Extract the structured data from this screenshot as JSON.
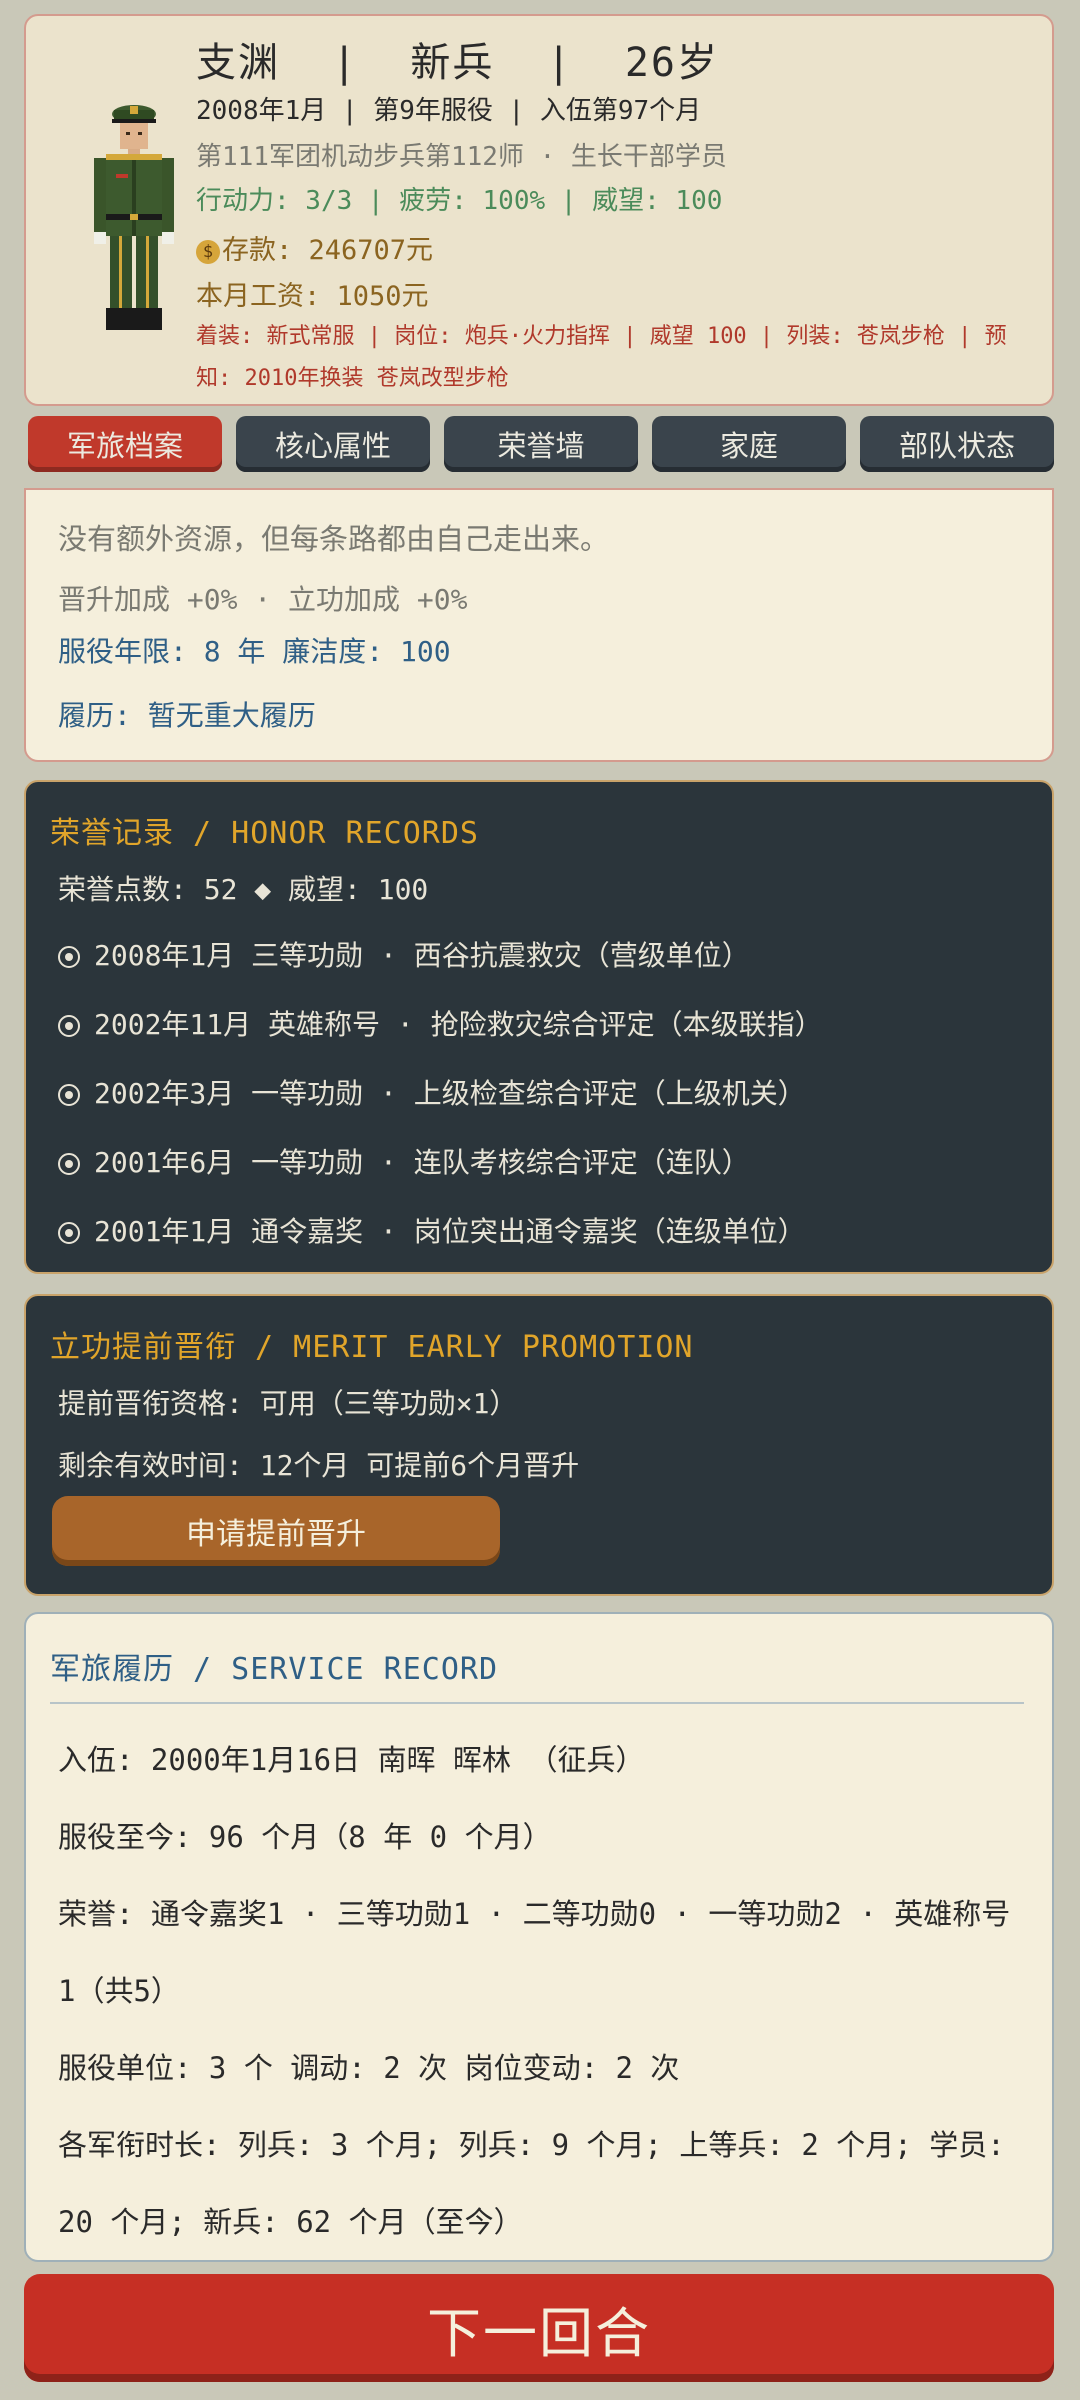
{
  "profile": {
    "name_line": "支渊  |  新兵  |  26岁",
    "date_line": "2008年1月 | 第9年服役 | 入伍第97个月",
    "unit_line": "第111军团机动步兵第112师 · 生长干部学员",
    "stat_line": "行动力: 3/3 | 疲劳: 100% | 威望: 100",
    "savings_icon": "money-bag-icon",
    "savings": "存款: 246707元",
    "wage": "本月工资: 1050元",
    "note": "着装: 新式常服 | 岗位: 炮兵·火力指挥 | 威望 100 | 列装: 苍岚步枪 | 预知: 2010年换装 苍岚改型步枪"
  },
  "tabs": [
    "军旅档案",
    "核心属性",
    "荣誉墙",
    "家庭",
    "部队状态"
  ],
  "active_tab": 0,
  "summary": {
    "motto": "没有额外资源，但每条路都由自己走出来。",
    "bonus": "晋升加成 +0% · 立功加成 +0%",
    "years": "服役年限: 8 年  廉洁度: 100",
    "resume": "履历: 暂无重大履历"
  },
  "honor": {
    "title": "荣誉记录 / HONOR RECORDS",
    "points": "荣誉点数: 52 ◆  威望: 100",
    "records": [
      "2008年1月 三等功勋 · 西谷抗震救灾（营级单位）",
      "2002年11月 英雄称号 · 抢险救灾综合评定（本级联指）",
      "2002年3月 一等功勋 · 上级检查综合评定（上级机关）",
      "2001年6月 一等功勋 · 连队考核综合评定（连队）",
      "2001年1月 通令嘉奖 · 岗位突出通令嘉奖（连级单位）"
    ]
  },
  "merit": {
    "title": "立功提前晋衔 / MERIT EARLY PROMOTION",
    "eligibility": "提前晋衔资格: 可用（三等功勋×1）",
    "remaining": "剩余有效时间: 12个月  可提前6个月晋升",
    "button": "申请提前晋升"
  },
  "service": {
    "title": "军旅履历 / SERVICE RECORD",
    "enlist": "入伍: 2000年1月16日  南晖 晖林  （征兵）",
    "duration": "服役至今: 96 个月（8 年 0 个月）",
    "honors": "荣誉: 通令嘉奖1 · 三等功勋1 · 二等功勋0 · 一等功勋2 · 英雄称号1（共5）",
    "units": "服役单位: 3 个  调动: 2 次  岗位变动: 2 次",
    "ranks": "各军衔时长: 列兵: 3 个月; 列兵: 9 个月; 上等兵: 2 个月; 学员: 20 个月; 新兵: 62 个月（至今）"
  },
  "next_button": "下一回合",
  "colors": {
    "background": "#c9c8b8",
    "accent_red": "#c0392b",
    "gold": "#e1a52a",
    "dark_panel": "#2b353b",
    "blue_text": "#2f5f86",
    "green_text": "#4b8b5a"
  }
}
